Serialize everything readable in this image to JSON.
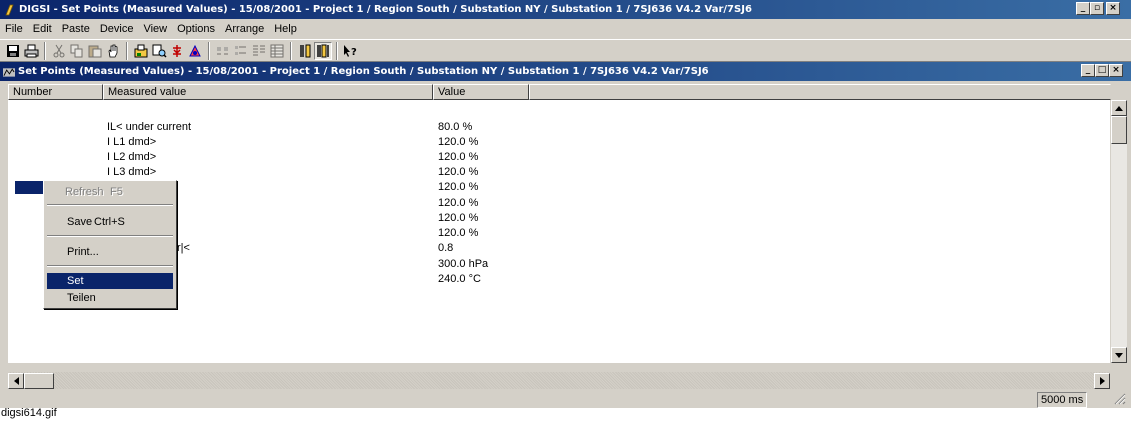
{
  "app": {
    "title": "DIGSI - Set Points (Measured Values) - 15/08/2001 - Project 1 / Region South / Substation NY / Substation 1 / 7SJ636 V4.2 Var/7SJ6",
    "icon": "digsi-app-icon"
  },
  "menubar": [
    "File",
    "Edit",
    "Paste",
    "Device",
    "View",
    "Options",
    "Arrange",
    "Help"
  ],
  "toolbar": {
    "buttons": [
      "save-icon",
      "print-icon",
      "cut-icon",
      "copy-icon",
      "paste-icon",
      "hand-icon",
      "properties-icon",
      "find-icon",
      "transfer-icon",
      "reconnect-icon",
      "large-icons-icon",
      "small-icons-icon",
      "list-icon",
      "details-icon",
      "device-icon",
      "device-pressed-icon",
      "whats-this-help-icon"
    ]
  },
  "child": {
    "title": "Set Points (Measured Values) - 15/08/2001 - Project 1 / Region South / Substation NY / Substation 1 / 7SJ636 V4.2 Var/7SJ6"
  },
  "table": {
    "headers": [
      "Number",
      "Measured value",
      "Value"
    ],
    "rows": [
      {
        "number": "",
        "name": "IL< under current",
        "value": "80.0 %"
      },
      {
        "number": "",
        "name": "I L1 dmd>",
        "value": "120.0 %"
      },
      {
        "number": "",
        "name": "I L2 dmd>",
        "value": "120.0 %"
      },
      {
        "number": "",
        "name": "I L3 dmd>",
        "value": "120.0 %"
      },
      {
        "number": "",
        "name": "",
        "value": "120.0 %"
      },
      {
        "number": "",
        "name": "",
        "value": "120.0 %"
      },
      {
        "number": "",
        "name": "",
        "value": "120.0 %"
      },
      {
        "number": "",
        "name": "",
        "value": "120.0 %"
      },
      {
        "number": "",
        "name": "r|<",
        "value": "0.8"
      },
      {
        "number": "",
        "name": "",
        "value": "300.0 hPa"
      },
      {
        "number": "",
        "name": "",
        "value": "240.0 °C"
      }
    ]
  },
  "context_menu": {
    "refresh": "Refresh",
    "refresh_key": "F5",
    "save": "Save",
    "save_key": "Ctrl+S",
    "print": "Print...",
    "set": "Set",
    "share": "Teilen"
  },
  "statusbar": {
    "timer": "5000 ms"
  },
  "caption": "digsi614.gif",
  "colors": {
    "title_active": "#0a246a",
    "face": "#d4d0c8",
    "highlight": "#0a246a"
  }
}
